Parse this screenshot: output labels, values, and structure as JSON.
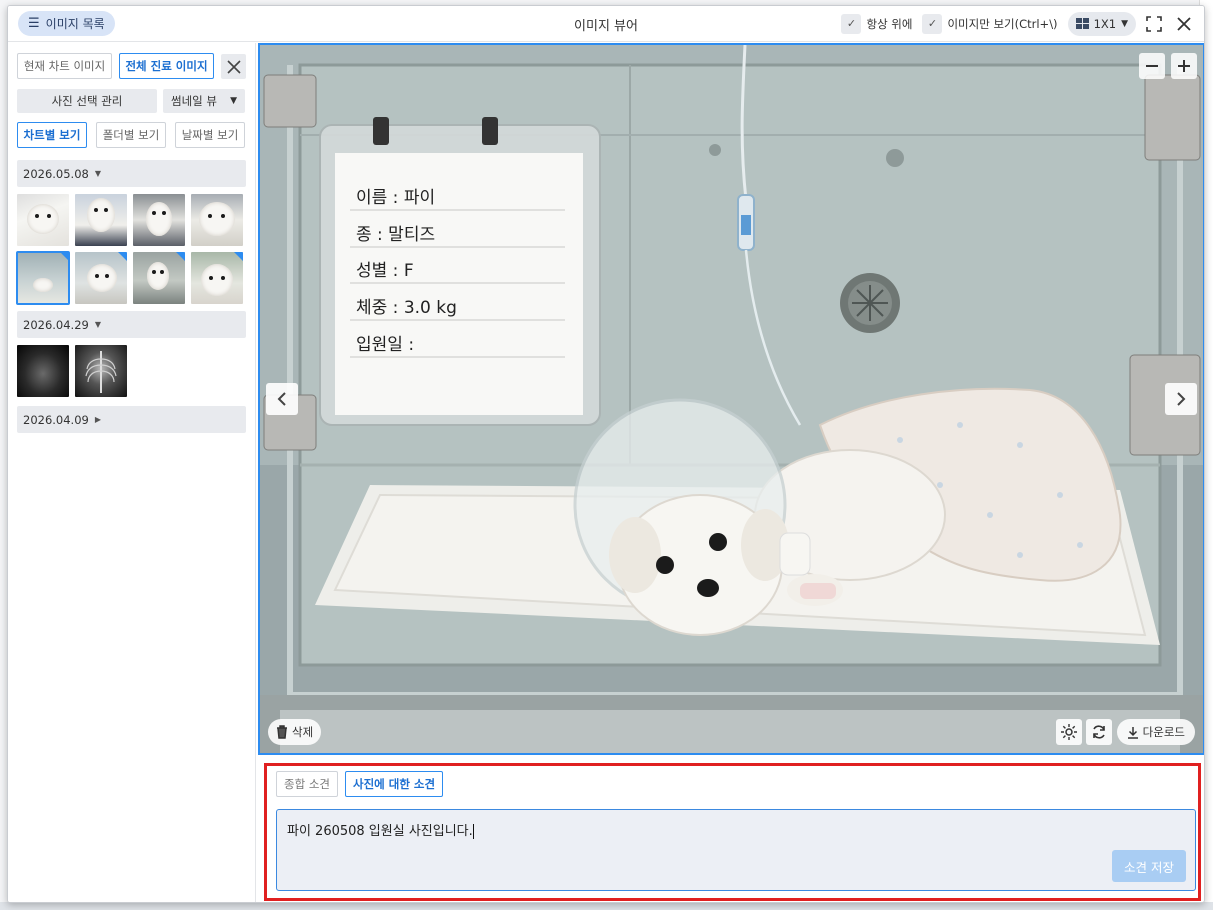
{
  "titlebar": {
    "list_toggle_label": "이미지 목록",
    "title": "이미지 뷰어",
    "always_on_top_label": "항상 위에",
    "image_only_label": "이미지만 보기(Ctrl+\\)",
    "layout_label": "1X1"
  },
  "sidebar": {
    "current_chart_label": "현재 차트 이미지",
    "all_visit_label": "전체 진료 이미지",
    "photo_select_label": "사진 선택 관리",
    "thumbnail_view_label": "썸네일 뷰",
    "by_chart_label": "차트별 보기",
    "by_folder_label": "폴더별 보기",
    "by_date_label": "날짜별 보기",
    "groups": [
      {
        "date": "2026.05.08",
        "expanded": true
      },
      {
        "date": "2026.04.29",
        "expanded": true
      },
      {
        "date": "2026.04.09",
        "expanded": false
      }
    ]
  },
  "viewer": {
    "card": {
      "line1": "이름 :  파이",
      "line2": "종   :  말티즈",
      "line3": "성별 :  F",
      "line4": "체중 :  3.0 kg",
      "line5": "입원일 :"
    },
    "delete_label": "삭제",
    "download_label": "다운로드"
  },
  "notes": {
    "tab_general_label": "종합 소견",
    "tab_photo_label": "사진에 대한 소견",
    "text": "파이 260508 입원실 사진입니다.",
    "save_label": "소견 저장"
  },
  "colors": {
    "accent": "#2d8cf0",
    "highlight_border": "#e02020"
  }
}
